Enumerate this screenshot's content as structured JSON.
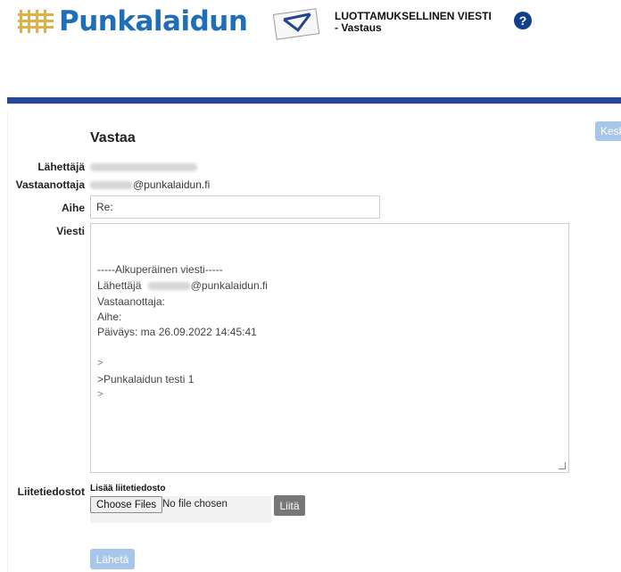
{
  "header": {
    "logo_text": "Punkalaidun",
    "message_title_line1": "LUOTTAMUKSELLINEN VIESTI",
    "message_title_line2": "- Vastaus",
    "help_symbol": "?"
  },
  "colors": {
    "brand_blue": "#1f6fb8",
    "bar_blue": "#26489a",
    "disabled_button": "#a8c5ea",
    "attach_button": "#777777"
  },
  "form": {
    "cancel_label": "Keskeytä",
    "heading": "Vastaa",
    "sender_label": "Lähettäjä",
    "recipient_label": "Vastaanottaja",
    "recipient_domain": "@punkalaidun.fi",
    "subject_label": "Aihe",
    "subject_value": "Re:",
    "message_label": "Viesti",
    "message_lines": {
      "original_header": "-----Alkuperäinen viesti-----",
      "sender": "Lähettäjä",
      "sender_domain": "@punkalaidun.fi",
      "recipient": "Vastaanottaja:",
      "subject": "Aihe:",
      "date": "Päiväys: ma 26.09.2022 14:45:41",
      "quote1": ">",
      "quote2": ">Punkalaidun testi 1",
      "quote3": ">"
    },
    "attachments_label": "Liitetiedostot",
    "add_attachment_label": "Lisää liitetiedosto",
    "choose_files_label": "Choose Files",
    "no_file_text": "No file chosen",
    "attach_button_label": "Liitä",
    "send_button_label": "Lähetä"
  }
}
